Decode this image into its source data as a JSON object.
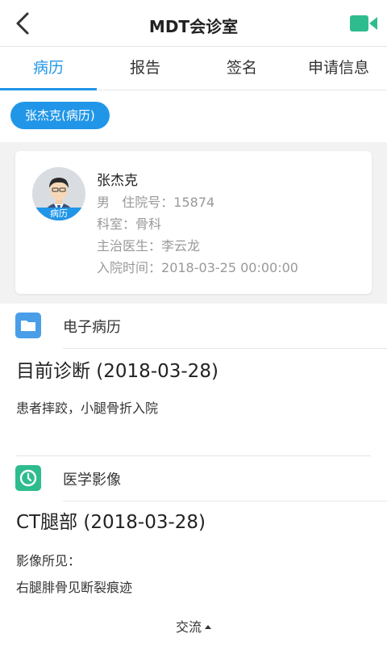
{
  "header": {
    "title": "MDT会诊室",
    "back_icon": "back-arrow-icon",
    "video_icon": "video-camera-icon",
    "accent": "#2ebc8f"
  },
  "tabs": [
    {
      "label": "病历",
      "active": true
    },
    {
      "label": "报告",
      "active": false
    },
    {
      "label": "签名",
      "active": false
    },
    {
      "label": "申请信息",
      "active": false
    }
  ],
  "patient_chip": "张杰克(病历)",
  "patient": {
    "badge": "病历",
    "name": "张杰克",
    "gender": "男",
    "admission_no_label": "住院号：",
    "admission_no": "15874",
    "department_label": "科室：",
    "department": "骨科",
    "doctor_label": "主治医生：",
    "doctor": "李云龙",
    "admit_time_label": "入院时间：",
    "admit_time": "2018-03-25 00:00:00"
  },
  "emr": {
    "section_title": "电子病历",
    "icon": "folder-icon",
    "diagnosis_title": "目前诊断 (2018-03-28)",
    "diagnosis_text": "患者摔跤，小腿骨折入院"
  },
  "imaging": {
    "section_title": "医学影像",
    "icon": "clock-icon",
    "exam_title": "CT腿部 (2018-03-28)",
    "findings_label": "影像所见：",
    "findings_text": "右腿腓骨见断裂痕迹"
  },
  "bottom": {
    "label": "交流"
  },
  "colors": {
    "primary": "#2196e8",
    "green": "#2ebc8f"
  }
}
